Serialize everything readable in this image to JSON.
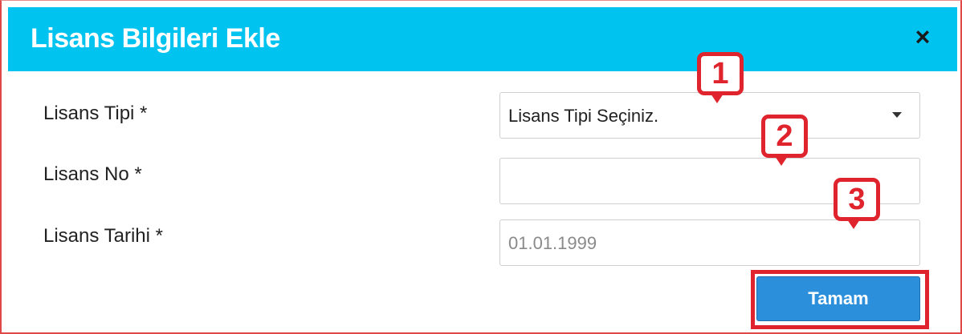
{
  "dialog": {
    "title": "Lisans Bilgileri Ekle",
    "close_symbol": "×"
  },
  "form": {
    "license_type": {
      "label": "Lisans Tipi  *",
      "selected_value": "Lisans Tipi Seçiniz."
    },
    "license_no": {
      "label": "Lisans No  *",
      "value": ""
    },
    "license_date": {
      "label": "Lisans Tarihi  *",
      "value": "01.01.1999"
    }
  },
  "callouts": [
    "1",
    "2",
    "3"
  ],
  "footer": {
    "submit_label": "Tamam"
  },
  "colors": {
    "header_bg": "#00c3f0",
    "button_bg": "#2b8fdc",
    "annotation_red": "#e0242e"
  }
}
